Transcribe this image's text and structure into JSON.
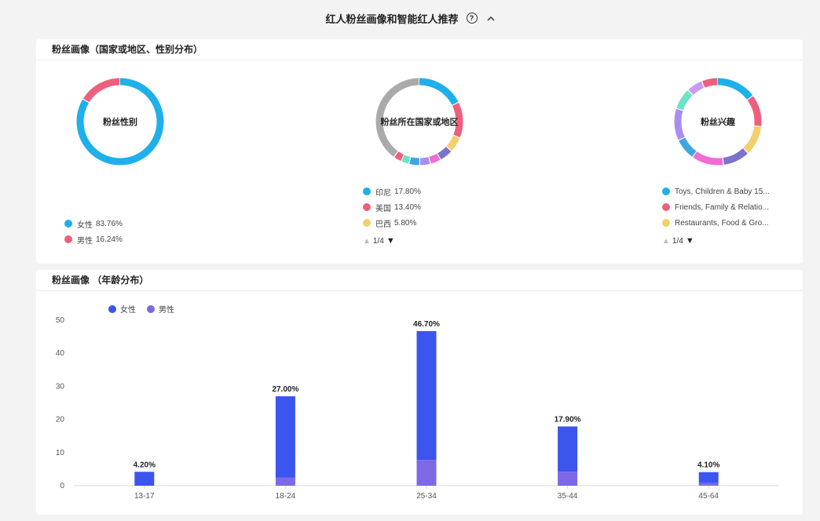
{
  "header": {
    "title": "红人粉丝画像和智能红人推荐",
    "help_icon": "?",
    "collapse_icon": "^"
  },
  "portrait_card": {
    "title": "粉丝画像（国家或地区、性别分布）",
    "gender": {
      "center_label": "粉丝性别",
      "segments": [
        {
          "label": "女性",
          "value": "83.76%",
          "pct": 83.76,
          "color": "#1eb0ea"
        },
        {
          "label": "男性",
          "value": "16.24%",
          "pct": 16.24,
          "color": "#ee5f7e"
        }
      ]
    },
    "country": {
      "center_label": "粉丝所在国家或地区",
      "legend": [
        {
          "label": "印尼",
          "value": "17.80%",
          "color": "#1eb0ea"
        },
        {
          "label": "美国",
          "value": "13.40%",
          "color": "#ee5f7e"
        },
        {
          "label": "巴西",
          "value": "5.80%",
          "color": "#f2d06b"
        }
      ],
      "segments": [
        {
          "pct": 17.8,
          "color": "#1eb0ea"
        },
        {
          "pct": 13.4,
          "color": "#ee5f7e"
        },
        {
          "pct": 5.8,
          "color": "#f2d06b"
        },
        {
          "pct": 5.0,
          "color": "#7b74cc"
        },
        {
          "pct": 4.0,
          "color": "#f06bd4"
        },
        {
          "pct": 4.0,
          "color": "#a98ef0"
        },
        {
          "pct": 4.0,
          "color": "#3da6e0"
        },
        {
          "pct": 3.0,
          "color": "#6fe3c5"
        },
        {
          "pct": 3.0,
          "color": "#ee5f7e"
        },
        {
          "pct": 40.0,
          "color": "#aaaaad"
        }
      ],
      "pager": "1/4"
    },
    "interest": {
      "center_label": "粉丝兴趣",
      "legend": [
        {
          "label": "Toys, Children & Baby 15...",
          "color": "#1eb0ea"
        },
        {
          "label": "Friends, Family & Relatio...",
          "color": "#ee5f7e"
        },
        {
          "label": "Restaurants, Food & Gro...",
          "color": "#f2d06b"
        }
      ],
      "segments": [
        {
          "pct": 15,
          "color": "#1eb0ea"
        },
        {
          "pct": 12,
          "color": "#ee5f7e"
        },
        {
          "pct": 11,
          "color": "#f2d06b"
        },
        {
          "pct": 10,
          "color": "#7b74cc"
        },
        {
          "pct": 12,
          "color": "#f06bd4"
        },
        {
          "pct": 8,
          "color": "#3da6e0"
        },
        {
          "pct": 12,
          "color": "#a98ef0"
        },
        {
          "pct": 8,
          "color": "#6fe3c5"
        },
        {
          "pct": 6,
          "color": "#c79bf0"
        },
        {
          "pct": 6,
          "color": "#ee5f7e"
        }
      ],
      "pager": "1/4"
    }
  },
  "age_card": {
    "title": "粉丝画像 （年龄分布）",
    "legend": [
      {
        "label": "女性",
        "color": "#3b55ee"
      },
      {
        "label": "男性",
        "color": "#7e68e6"
      }
    ]
  },
  "chart_data": {
    "type": "bar",
    "stacked": true,
    "categories": [
      "13-17",
      "18-24",
      "25-34",
      "35-44",
      "45-64"
    ],
    "series": [
      {
        "name": "女性",
        "color": "#3b55ee",
        "values": [
          4.2,
          24.6,
          38.9,
          13.7,
          3.3
        ]
      },
      {
        "name": "男性",
        "color": "#7e68e6",
        "values": [
          0,
          2.4,
          7.8,
          4.2,
          0.8
        ]
      }
    ],
    "totals": [
      4.2,
      27.0,
      46.7,
      17.9,
      4.1
    ],
    "data_labels": [
      "4.20%",
      "27.00%",
      "46.70%",
      "17.90%",
      "4.10%"
    ],
    "y_ticks": [
      "0",
      "10",
      "20",
      "30",
      "40",
      "50"
    ],
    "ylim": [
      0,
      50
    ]
  }
}
